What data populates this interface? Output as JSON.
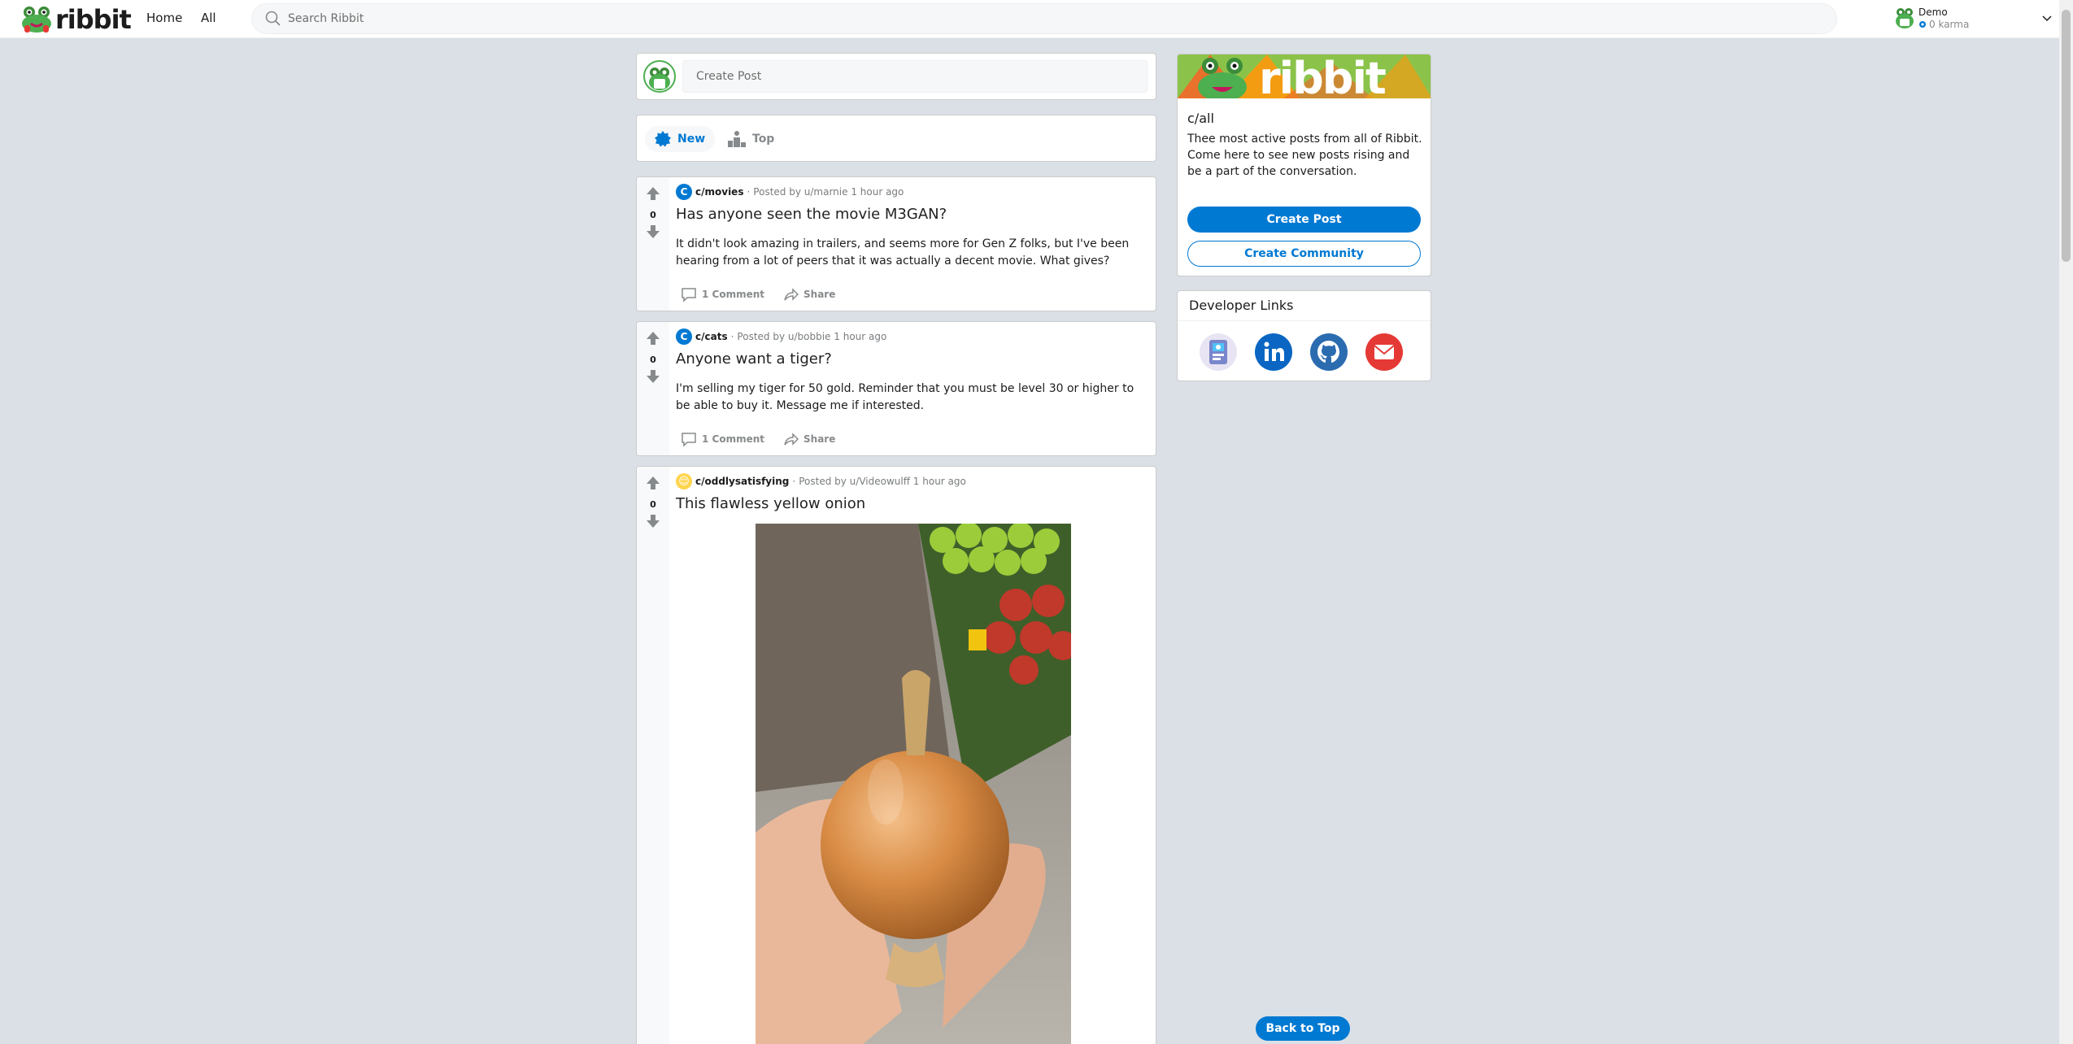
{
  "header": {
    "logo_text": "ribbit",
    "nav": [
      "Home",
      "All"
    ],
    "search_placeholder": "Search Ribbit",
    "user": {
      "name": "Demo",
      "karma": "0 karma"
    }
  },
  "create_post": {
    "placeholder": "Create Post"
  },
  "sort": {
    "new_label": "New",
    "top_label": "Top"
  },
  "posts": [
    {
      "community": "c/movies",
      "community_icon": "C",
      "posted_by": "Posted by u/marnie",
      "time": "1 hour ago",
      "votes": "0",
      "title": "Has anyone seen the movie M3GAN?",
      "body": "It didn't look amazing in trailers, and seems more for Gen Z folks, but I've been hearing from a lot of peers that it was actually a decent movie. What gives?",
      "comments": "1 Comment",
      "share": "Share"
    },
    {
      "community": "c/cats",
      "community_icon": "C",
      "posted_by": "Posted by u/bobbie",
      "time": "1 hour ago",
      "votes": "0",
      "title": "Anyone want a tiger?",
      "body": "I'm selling my tiger for 50 gold. Reminder that you must be level 30 or higher to be able to buy it. Message me if interested.",
      "comments": "1 Comment",
      "share": "Share"
    },
    {
      "community": "c/oddlysatisfying",
      "community_icon": "😌",
      "posted_by": "Posted by u/Videowulff",
      "time": "1 hour ago",
      "votes": "0",
      "title": "This flawless yellow onion"
    }
  ],
  "sidebar": {
    "banner_text": "ribbit",
    "title": "c/all",
    "description": "Thee most active posts from all of Ribbit. Come here to see new posts rising and be a part of the conversation.",
    "create_post": "Create Post",
    "create_community": "Create Community",
    "dev_links_title": "Developer Links",
    "dev_links": [
      "portfolio-icon",
      "linkedin-icon",
      "github-icon",
      "email-icon"
    ]
  },
  "back_to_top": "Back to Top",
  "colors": {
    "accent": "#0079d3",
    "background": "#dae0e6",
    "brand_green": "#8bc34a"
  }
}
